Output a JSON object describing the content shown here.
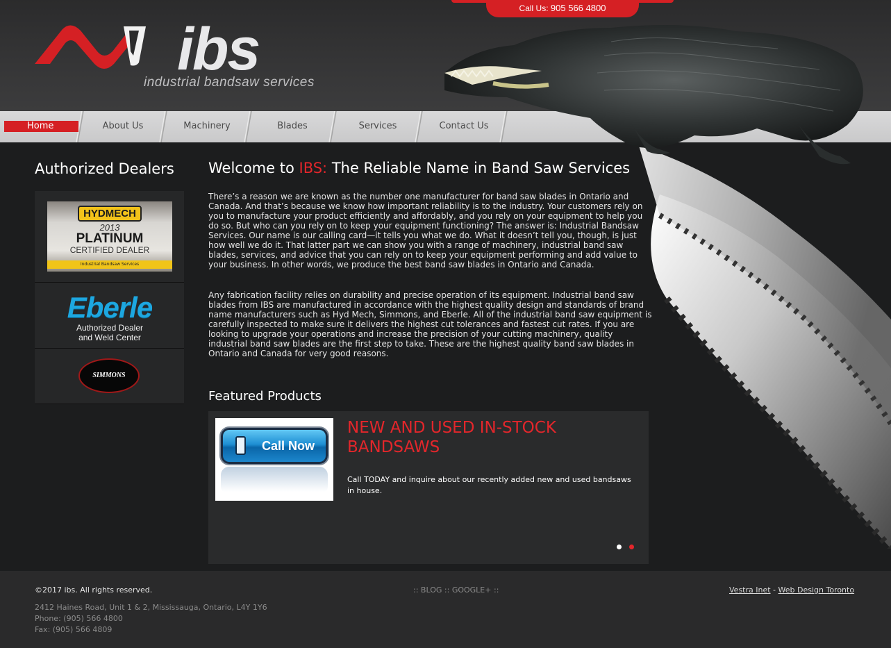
{
  "topbar": {
    "call_label": "Call Us:",
    "phone": "905 566 4800"
  },
  "logo": {
    "word": "ibs",
    "tagline": "industrial bandsaw services"
  },
  "nav": {
    "items": [
      {
        "label": "Home"
      },
      {
        "label": "About Us"
      },
      {
        "label": "Machinery"
      },
      {
        "label": "Blades"
      },
      {
        "label": "Services"
      },
      {
        "label": "Contact Us"
      }
    ],
    "active": "Home"
  },
  "sidebar": {
    "title": "Authorized Dealers",
    "hydmech": {
      "brand": "HYDMECH",
      "year": "2013",
      "level": "PLATINUM",
      "cert": "CERTIFIED DEALER",
      "strip": "Industrial Bandsaw Services"
    },
    "eberle": {
      "brand": "Eberle",
      "line1": "Authorized Dealer",
      "line2": "and Weld Center"
    },
    "simmons": {
      "brand": "SIMMONS"
    }
  },
  "main": {
    "title_pre": "Welcome to ",
    "title_brand": "IBS:",
    "title_post": " The Reliable Name in Band Saw Services",
    "paragraph1": "There’s a reason we are known as the number one manufacturer for band saw blades in Ontario and Canada. And that’s because we know how important reliability is to the industry. Your customers rely on you to manufacture your product efficiently and affordably, and you rely on your equipment to help you do so. But who can you rely on to keep your equipment functioning? The answer is: Industrial Bandsaw Services. Our name is our calling card—it tells you what we do. What it doesn’t tell you, though, is just how well we do it. That latter part we can show you with a range of machinery, industrial band saw blades, services, and advice that you can rely on to keep your equipment performing and add value to your business. In other words, we produce the best band saw blades in Ontario and Canada.",
    "paragraph2": "Any fabrication facility relies on durability and precise operation of its equipment. Industrial band saw blades from IBS are manufactured in accordance with the highest quality design and standards of brand name manufacturers such as Hyd Mech, Simmons, and Eberle. All of the industrial band saw equipment is carefully inspected to make sure it delivers the highest cut tolerances and fastest cut rates. If you are looking to upgrade your operations and increase the precision of your cutting machinery, quality industrial band saw blades are the first step to take. These are the highest quality band saw blades in Ontario and Canada for very good reasons."
  },
  "featured": {
    "title": "Featured Products",
    "button_label": "Call Now",
    "heading": "NEW AND USED IN-STOCK BANDSAWS",
    "text": "Call TODAY and inquire about our recently added new and used bandsaws in house.",
    "slides_count": 2,
    "active_slide": 1
  },
  "footer": {
    "copyright": "©2017 ibs. All rights reserved.",
    "address": "2412 Haines Road, Unit 1 & 2, Mississauga, Ontario, L4Y 1Y6",
    "phone": "Phone: (905) 566 4800",
    "fax": "Fax: (905) 566 4809",
    "links_prefix": "::",
    "blog": "BLOG",
    "sep": "::",
    "google": "GOOGLE+",
    "links_suffix": "::",
    "credit_1": "Vestra Inet",
    "credit_sep": " - ",
    "credit_2": "Web Design Toronto"
  },
  "colors": {
    "brand_red": "#d52024",
    "accent_red": "#e3262b",
    "background": "#1c1d1e",
    "nav_bg": "#d0d0d1",
    "footer_bg": "#2a2a2b"
  }
}
